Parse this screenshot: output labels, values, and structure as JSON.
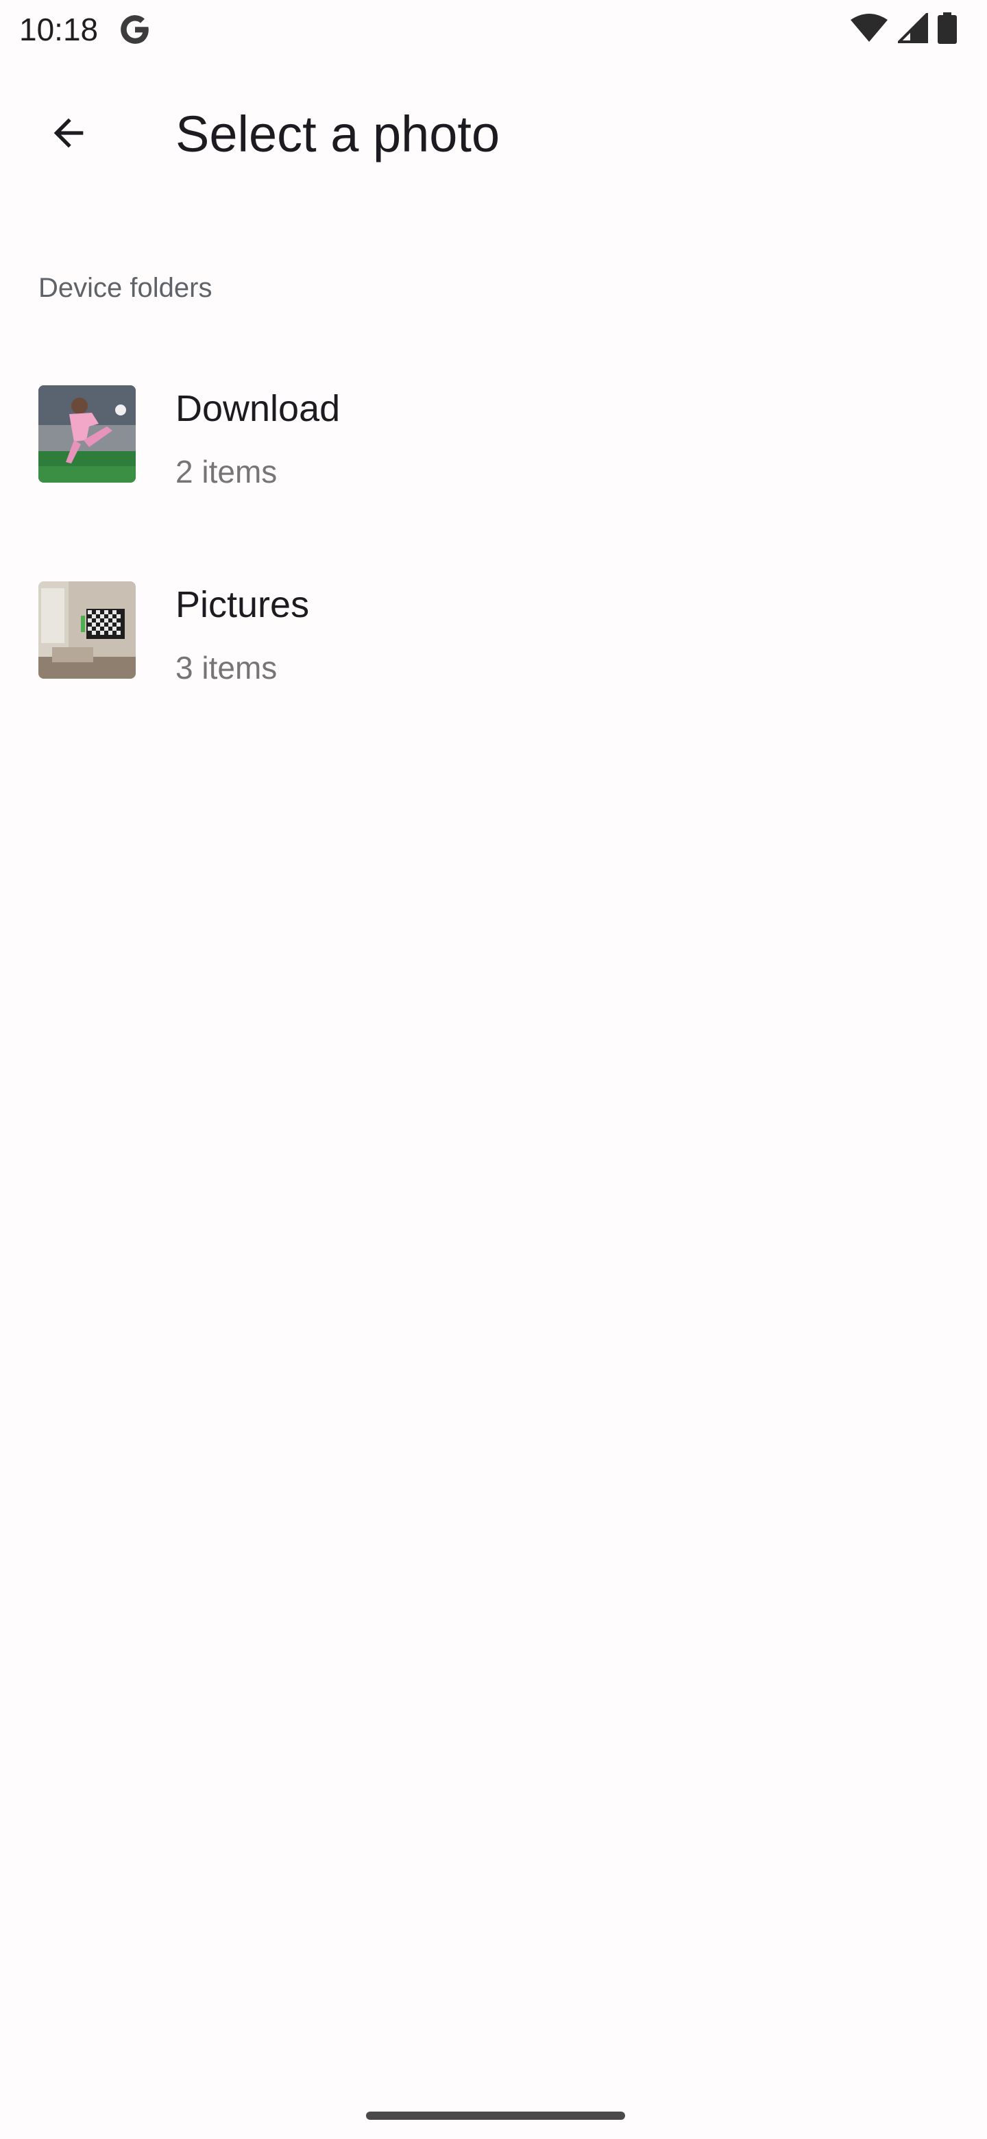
{
  "status_bar": {
    "time": "10:18",
    "icons": [
      "google-g-icon",
      "wifi-icon",
      "cellular-signal-icon",
      "battery-icon"
    ]
  },
  "app_bar": {
    "back_icon": "arrow-back-icon",
    "title": "Select a photo"
  },
  "section": {
    "header": "Device folders"
  },
  "folders": [
    {
      "name": "Download",
      "count": "2 items",
      "thumbnail": "soccer-player-thumbnail"
    },
    {
      "name": "Pictures",
      "count": "3 items",
      "thumbnail": "living-room-tv-thumbnail"
    }
  ],
  "colors": {
    "background": "#fefcfc",
    "title_text": "#1c1b1f",
    "secondary_text": "#757575",
    "section_header_text": "#5f6368"
  }
}
